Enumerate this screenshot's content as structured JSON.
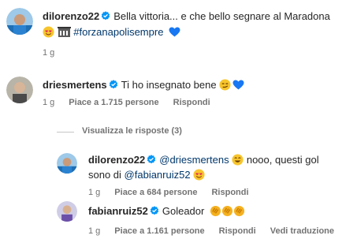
{
  "comments": [
    {
      "username": "dilorenzo22",
      "text": "Bella vittoria... e che bello segnare al Maradona",
      "hashtag": "#forzanapolisempre",
      "time": "1 g"
    },
    {
      "username": "driesmertens",
      "text": "Ti ho insegnato bene",
      "time": "1 g",
      "likes": "Piace a 1.715 persone",
      "reply": "Rispondi"
    }
  ],
  "view_replies": "Visualizza le risposte (3)",
  "replies": [
    {
      "username": "dilorenzo22",
      "mention1": "@driesmertens",
      "text1": "nooo, questi gol",
      "text2": "sono di",
      "mention2": "@fabianruiz52",
      "time": "1 g",
      "likes": "Piace a 684 persone",
      "reply": "Rispondi"
    },
    {
      "username": "fabianruiz52",
      "text": "Goleador",
      "time": "1 g",
      "likes": "Piace a 1.161 persone",
      "reply": "Rispondi",
      "translate": "Vedi traduzione"
    }
  ],
  "colors": {
    "verified": "#0095f6",
    "heart": "#1877f2",
    "link": "#00376b"
  }
}
